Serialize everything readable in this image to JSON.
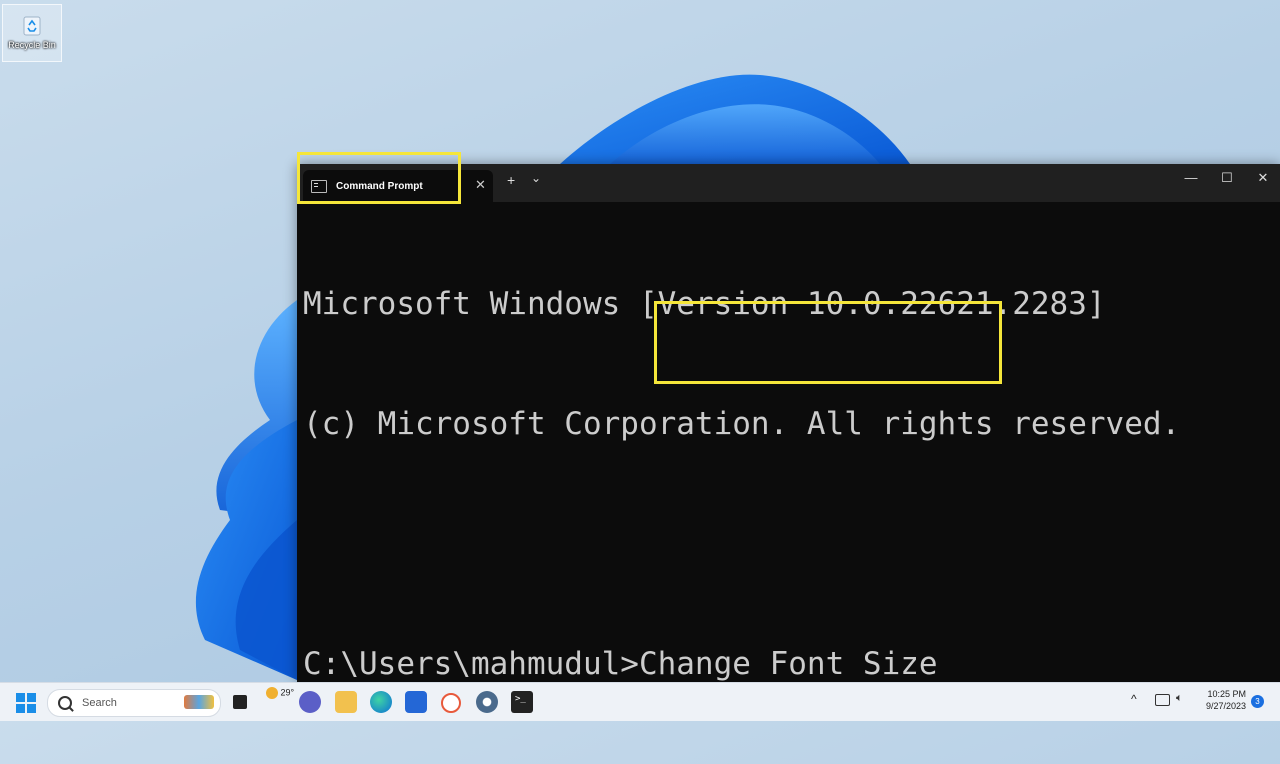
{
  "desktop": {
    "icons": [
      {
        "label": "Recycle Bin",
        "icon": "recycle-bin-icon"
      }
    ]
  },
  "window": {
    "tab_title": "Command Prompt",
    "tab_icon": "command-prompt-icon",
    "tab_close": "✕",
    "new_tab": "+",
    "dropdown": "⌄",
    "minimize": "—",
    "maximize": "☐",
    "close": "✕",
    "console_lines": [
      "Microsoft Windows [Version 10.0.22621.2283]",
      "(c) Microsoft Corporation. All rights reserved.",
      "",
      "C:\\Users\\mahmudul>Change Font Size"
    ]
  },
  "taskbar": {
    "search_placeholder": "Search",
    "weather_temp": "29°",
    "time": "10:25 PM",
    "date": "9/27/2023",
    "notification_count": "3",
    "apps": [
      "task-view-icon",
      "teams-chat-icon",
      "file-explorer-icon",
      "edge-icon",
      "store-icon",
      "office-icon",
      "settings-icon",
      "terminal-icon"
    ]
  },
  "colors": {
    "highlight": "#f5e63a",
    "console_bg": "#0c0c0c",
    "console_text": "#cccccc",
    "accent": "#1a8ee8"
  }
}
